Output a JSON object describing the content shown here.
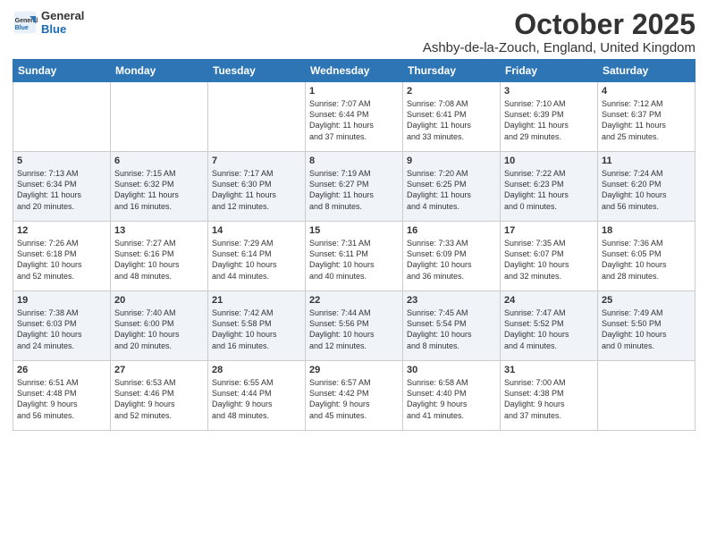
{
  "header": {
    "logo_general": "General",
    "logo_blue": "Blue",
    "month_title": "October 2025",
    "subtitle": "Ashby-de-la-Zouch, England, United Kingdom"
  },
  "weekdays": [
    "Sunday",
    "Monday",
    "Tuesday",
    "Wednesday",
    "Thursday",
    "Friday",
    "Saturday"
  ],
  "weeks": [
    [
      {
        "day": "",
        "info": ""
      },
      {
        "day": "",
        "info": ""
      },
      {
        "day": "",
        "info": ""
      },
      {
        "day": "1",
        "info": "Sunrise: 7:07 AM\nSunset: 6:44 PM\nDaylight: 11 hours\nand 37 minutes."
      },
      {
        "day": "2",
        "info": "Sunrise: 7:08 AM\nSunset: 6:41 PM\nDaylight: 11 hours\nand 33 minutes."
      },
      {
        "day": "3",
        "info": "Sunrise: 7:10 AM\nSunset: 6:39 PM\nDaylight: 11 hours\nand 29 minutes."
      },
      {
        "day": "4",
        "info": "Sunrise: 7:12 AM\nSunset: 6:37 PM\nDaylight: 11 hours\nand 25 minutes."
      }
    ],
    [
      {
        "day": "5",
        "info": "Sunrise: 7:13 AM\nSunset: 6:34 PM\nDaylight: 11 hours\nand 20 minutes."
      },
      {
        "day": "6",
        "info": "Sunrise: 7:15 AM\nSunset: 6:32 PM\nDaylight: 11 hours\nand 16 minutes."
      },
      {
        "day": "7",
        "info": "Sunrise: 7:17 AM\nSunset: 6:30 PM\nDaylight: 11 hours\nand 12 minutes."
      },
      {
        "day": "8",
        "info": "Sunrise: 7:19 AM\nSunset: 6:27 PM\nDaylight: 11 hours\nand 8 minutes."
      },
      {
        "day": "9",
        "info": "Sunrise: 7:20 AM\nSunset: 6:25 PM\nDaylight: 11 hours\nand 4 minutes."
      },
      {
        "day": "10",
        "info": "Sunrise: 7:22 AM\nSunset: 6:23 PM\nDaylight: 11 hours\nand 0 minutes."
      },
      {
        "day": "11",
        "info": "Sunrise: 7:24 AM\nSunset: 6:20 PM\nDaylight: 10 hours\nand 56 minutes."
      }
    ],
    [
      {
        "day": "12",
        "info": "Sunrise: 7:26 AM\nSunset: 6:18 PM\nDaylight: 10 hours\nand 52 minutes."
      },
      {
        "day": "13",
        "info": "Sunrise: 7:27 AM\nSunset: 6:16 PM\nDaylight: 10 hours\nand 48 minutes."
      },
      {
        "day": "14",
        "info": "Sunrise: 7:29 AM\nSunset: 6:14 PM\nDaylight: 10 hours\nand 44 minutes."
      },
      {
        "day": "15",
        "info": "Sunrise: 7:31 AM\nSunset: 6:11 PM\nDaylight: 10 hours\nand 40 minutes."
      },
      {
        "day": "16",
        "info": "Sunrise: 7:33 AM\nSunset: 6:09 PM\nDaylight: 10 hours\nand 36 minutes."
      },
      {
        "day": "17",
        "info": "Sunrise: 7:35 AM\nSunset: 6:07 PM\nDaylight: 10 hours\nand 32 minutes."
      },
      {
        "day": "18",
        "info": "Sunrise: 7:36 AM\nSunset: 6:05 PM\nDaylight: 10 hours\nand 28 minutes."
      }
    ],
    [
      {
        "day": "19",
        "info": "Sunrise: 7:38 AM\nSunset: 6:03 PM\nDaylight: 10 hours\nand 24 minutes."
      },
      {
        "day": "20",
        "info": "Sunrise: 7:40 AM\nSunset: 6:00 PM\nDaylight: 10 hours\nand 20 minutes."
      },
      {
        "day": "21",
        "info": "Sunrise: 7:42 AM\nSunset: 5:58 PM\nDaylight: 10 hours\nand 16 minutes."
      },
      {
        "day": "22",
        "info": "Sunrise: 7:44 AM\nSunset: 5:56 PM\nDaylight: 10 hours\nand 12 minutes."
      },
      {
        "day": "23",
        "info": "Sunrise: 7:45 AM\nSunset: 5:54 PM\nDaylight: 10 hours\nand 8 minutes."
      },
      {
        "day": "24",
        "info": "Sunrise: 7:47 AM\nSunset: 5:52 PM\nDaylight: 10 hours\nand 4 minutes."
      },
      {
        "day": "25",
        "info": "Sunrise: 7:49 AM\nSunset: 5:50 PM\nDaylight: 10 hours\nand 0 minutes."
      }
    ],
    [
      {
        "day": "26",
        "info": "Sunrise: 6:51 AM\nSunset: 4:48 PM\nDaylight: 9 hours\nand 56 minutes."
      },
      {
        "day": "27",
        "info": "Sunrise: 6:53 AM\nSunset: 4:46 PM\nDaylight: 9 hours\nand 52 minutes."
      },
      {
        "day": "28",
        "info": "Sunrise: 6:55 AM\nSunset: 4:44 PM\nDaylight: 9 hours\nand 48 minutes."
      },
      {
        "day": "29",
        "info": "Sunrise: 6:57 AM\nSunset: 4:42 PM\nDaylight: 9 hours\nand 45 minutes."
      },
      {
        "day": "30",
        "info": "Sunrise: 6:58 AM\nSunset: 4:40 PM\nDaylight: 9 hours\nand 41 minutes."
      },
      {
        "day": "31",
        "info": "Sunrise: 7:00 AM\nSunset: 4:38 PM\nDaylight: 9 hours\nand 37 minutes."
      },
      {
        "day": "",
        "info": ""
      }
    ]
  ]
}
